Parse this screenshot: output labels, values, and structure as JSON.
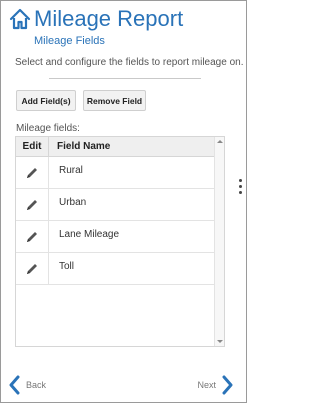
{
  "header": {
    "title": "Mileage Report",
    "subtitle": "Mileage Fields",
    "icon": "home-icon",
    "accent_color": "#2a73b8"
  },
  "instructions": "Select and configure the fields to report mileage on.",
  "toolbar": {
    "add_label": "Add Field(s)",
    "remove_label": "Remove Field"
  },
  "fields_label": "Mileage fields:",
  "table": {
    "columns": [
      "Edit",
      "Field Name"
    ],
    "rows": [
      {
        "name": "Rural",
        "edit_icon": "pencil-icon"
      },
      {
        "name": "Urban",
        "edit_icon": "pencil-icon"
      },
      {
        "name": "Lane Mileage",
        "edit_icon": "pencil-icon"
      },
      {
        "name": "Toll",
        "edit_icon": "pencil-icon"
      }
    ]
  },
  "footer": {
    "back_label": "Back",
    "next_label": "Next",
    "back_icon": "chevron-left-icon",
    "next_icon": "chevron-right-icon"
  }
}
